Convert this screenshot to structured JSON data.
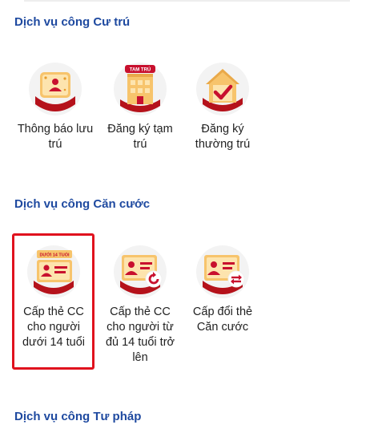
{
  "sections": [
    {
      "title": "Dịch vụ công Cư trú",
      "items": [
        {
          "label": "Thông báo lưu trú",
          "icon": "notice-card-icon"
        },
        {
          "label": "Đăng ký tạm trú",
          "icon": "tam-tru-building-icon",
          "badge": "TAM TRÚ"
        },
        {
          "label": "Đăng ký thường trú",
          "icon": "house-check-icon"
        }
      ]
    },
    {
      "title": "Dịch vụ công Căn cước",
      "items": [
        {
          "label": "Cấp thẻ CC cho người dưới 14 tuổi",
          "icon": "id-card-under-14-icon",
          "badge": "DƯỚI 14 TUỔI",
          "selected": true
        },
        {
          "label": "Cấp thẻ CC cho người từ đủ 14 tuổi trở lên",
          "icon": "id-card-refresh-icon"
        },
        {
          "label": "Cấp đổi thẻ Căn cước",
          "icon": "id-card-exchange-icon"
        }
      ]
    },
    {
      "title": "Dịch vụ công Tư pháp",
      "items": []
    }
  ],
  "colors": {
    "section_title": "#1f4aa0",
    "accent_red": "#c8102e",
    "icon_bg": "#f3f3f3",
    "gold": "#f7c46c",
    "highlight": "#e0121e"
  }
}
